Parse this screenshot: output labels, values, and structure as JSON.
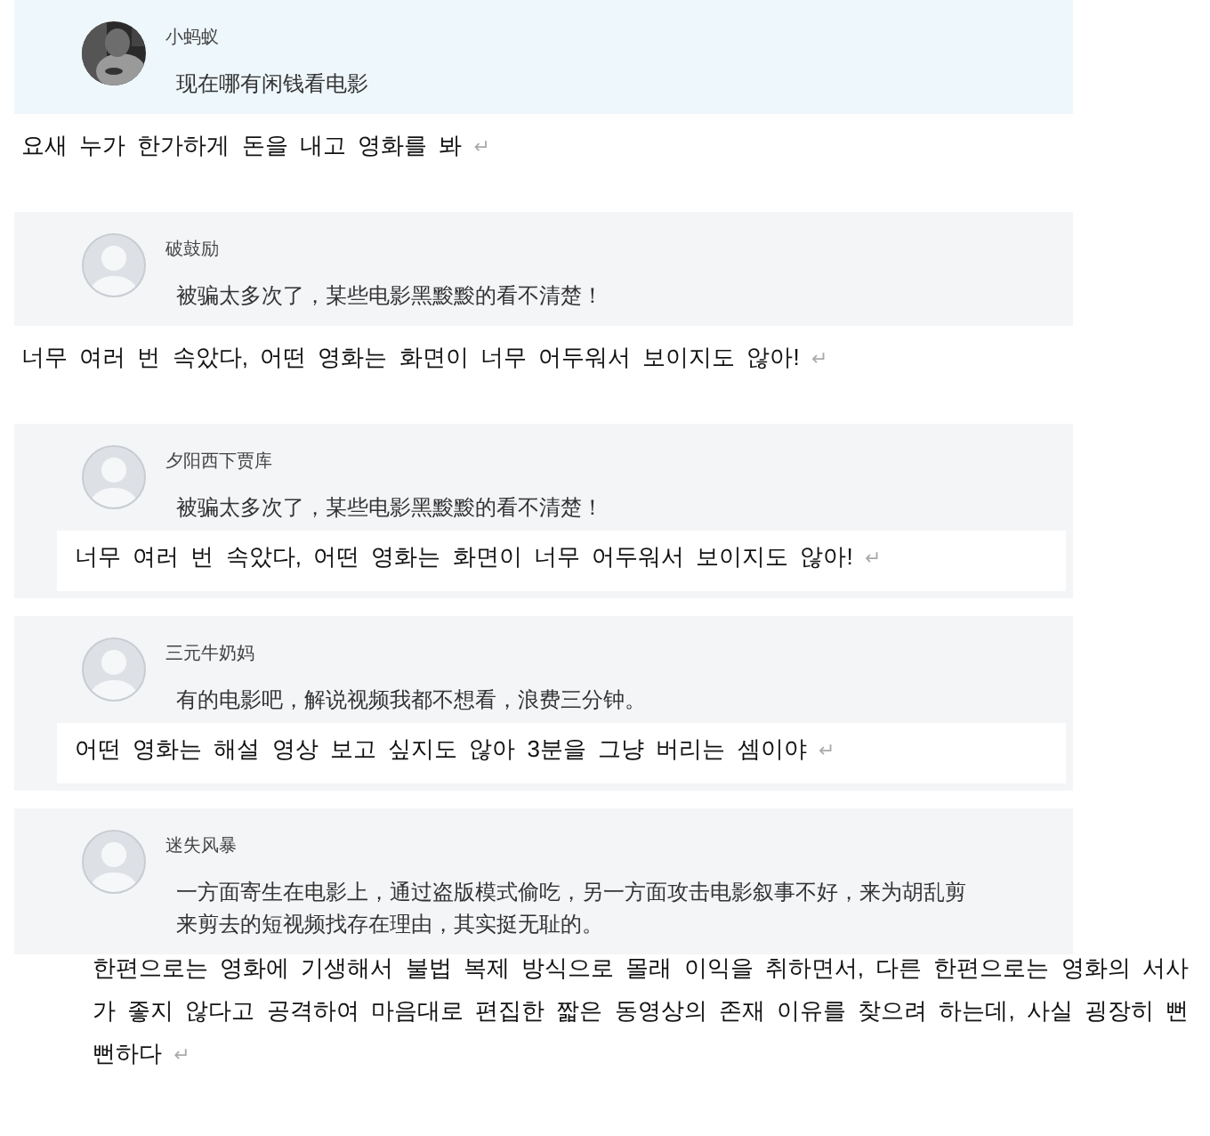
{
  "comments": [
    {
      "user": "小蚂蚁",
      "color": "#eef7fb",
      "text": "现在哪有闲钱看电影",
      "translation": {
        "kind": "plain",
        "text": "요새 누가 한가하게 돈을 내고 영화를 봐",
        "end_mark": "↵"
      }
    },
    {
      "user": "破鼓励",
      "avatar": {
        "kind": "default"
      },
      "color": "#f4f5f7",
      "text": "被骗太多次了，某些电影黑黢黢的看不清楚！",
      "translation": {
        "kind": "plain",
        "text": "너무 여러 번 속았다, 어떤 영화는 화면이 너무 어두워서 보이지도 않아!",
        "end_mark": "↵"
      }
    },
    {
      "user": "夕阳西下贾库",
      "avatar": {
        "kind": "default"
      },
      "color": "#f4f5f7",
      "text": "被骗太多次了，某些电影黑黢黢的看不清楚！",
      "translation": {
        "kind": "inset",
        "text": "너무 여러 번 속았다, 어떤 영화는 화면이 너무 어두워서 보이지도 않아!",
        "end_mark": "↵"
      }
    },
    {
      "user": "三元牛奶妈",
      "avatar": {
        "kind": "default"
      },
      "color": "#f4f5f7",
      "text": "有的电影吧，解说视频我都不想看，浪费三分钟。",
      "translation": {
        "kind": "inset",
        "text": "어떤 영화는 해설 영상 보고 싶지도 않아 3분을 그냥 버리는 셈이야",
        "end_mark": "↵"
      }
    },
    {
      "user": "迷失风暴",
      "avatar": {
        "kind": "default"
      },
      "color": "#f4f5f7",
      "text": "一方面寄生在电影上，通过盗版模式偷吃，另一方面攻击电影叙事不好，来为胡乱剪来剪去的短视频找存在理由，其实挺无耻的。",
      "translation": {
        "kind": "wide",
        "text": "한편으로는 영화에 기생해서 불법 복제 방식으로 몰래 이익을 취하면서, 다른 한편으로는 영화의 서사가 좋지 않다고 공격하여 마음대로 편집한 짧은 동영상의 존재 이유를 찾으려 하는데, 사실 굉장히 뻔뻔하다",
        "end_mark": "↵"
      }
    }
  ]
}
